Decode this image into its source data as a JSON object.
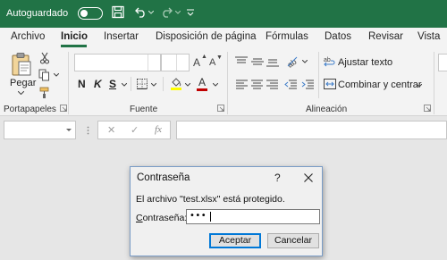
{
  "titlebar": {
    "autosave_label": "Autoguardado",
    "icons": [
      "save-icon",
      "undo-icon",
      "redo-icon",
      "customize-qat-icon"
    ]
  },
  "tabs": [
    {
      "label": "Archivo"
    },
    {
      "label": "Inicio",
      "active": true
    },
    {
      "label": "Insertar"
    },
    {
      "label": "Disposición de página"
    },
    {
      "label": "Fórmulas"
    },
    {
      "label": "Datos"
    },
    {
      "label": "Revisar"
    },
    {
      "label": "Vista"
    }
  ],
  "ribbon": {
    "clipboard": {
      "paste_label": "Pegar",
      "group_label": "Portapapeles"
    },
    "font": {
      "group_label": "Fuente",
      "bold": "N",
      "italic": "K",
      "underline": "S",
      "grow_font": "A",
      "shrink_font": "A",
      "font_color_glyph": "A"
    },
    "alignment": {
      "group_label": "Alineación",
      "wrap_text": "Ajustar texto",
      "merge_center": "Combinar y centrar"
    }
  },
  "formula_bar": {
    "cancel_glyph": "✕",
    "enter_glyph": "✓",
    "fx_glyph": "fx"
  },
  "dialog": {
    "title": "Contraseña",
    "help_glyph": "?",
    "message": "El archivo \"test.xlsx\" está protegido.",
    "password_label": "Contraseña:",
    "password_value": "•••",
    "ok_label": "Aceptar",
    "cancel_label": "Cancelar"
  },
  "colors": {
    "brand": "#217346",
    "ribbon_bg": "#f3f3f3",
    "dialog_border": "#7a9cc6",
    "default_button_border": "#0078d7",
    "highlight": "#ffff00",
    "font_color": "#c00000"
  }
}
